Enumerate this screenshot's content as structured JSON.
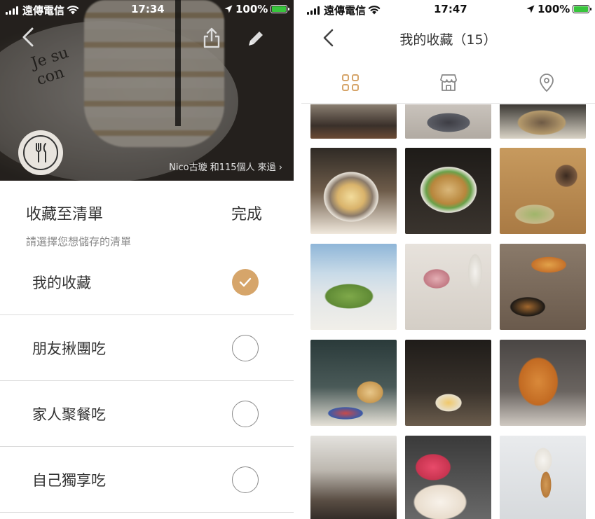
{
  "left": {
    "status": {
      "carrier": "遠傳電信",
      "time": "17:34",
      "battery": "100%"
    },
    "hero": {
      "plate_text": "Je su\ncon",
      "visitors": "Nico古璇 和115個人 來過 ›"
    },
    "sheet": {
      "title": "收藏至清單",
      "done": "完成",
      "hint": "請選擇您想儲存的清單",
      "lists": [
        {
          "label": "我的收藏",
          "checked": true
        },
        {
          "label": "朋友揪團吃",
          "checked": false
        },
        {
          "label": "家人聚餐吃",
          "checked": false
        },
        {
          "label": "自己獨享吃",
          "checked": false
        }
      ]
    }
  },
  "right": {
    "status": {
      "carrier": "遠傳電信",
      "time": "17:47",
      "battery": "100%"
    },
    "title": "我的收藏（15）",
    "tabs": [
      "grid-icon",
      "store-icon",
      "location-pin-icon"
    ],
    "accent": "#d6a56a",
    "photos": [
      {
        "name": "photo-cafe-interior"
      },
      {
        "name": "photo-coffee-cup"
      },
      {
        "name": "photo-dessert-plate"
      },
      {
        "name": "photo-pancake-plate"
      },
      {
        "name": "photo-taro-ball-dessert"
      },
      {
        "name": "photo-matcha-toast-tray"
      },
      {
        "name": "photo-matcha-crepe-cake"
      },
      {
        "name": "photo-pink-latte-set"
      },
      {
        "name": "photo-brunch-platter"
      },
      {
        "name": "photo-cream-puff-cake"
      },
      {
        "name": "photo-fruit-tart-latte"
      },
      {
        "name": "photo-iced-milk-tea"
      },
      {
        "name": "photo-shop-interior"
      },
      {
        "name": "photo-strawberry-cake"
      },
      {
        "name": "photo-soft-serve-cone"
      }
    ]
  }
}
